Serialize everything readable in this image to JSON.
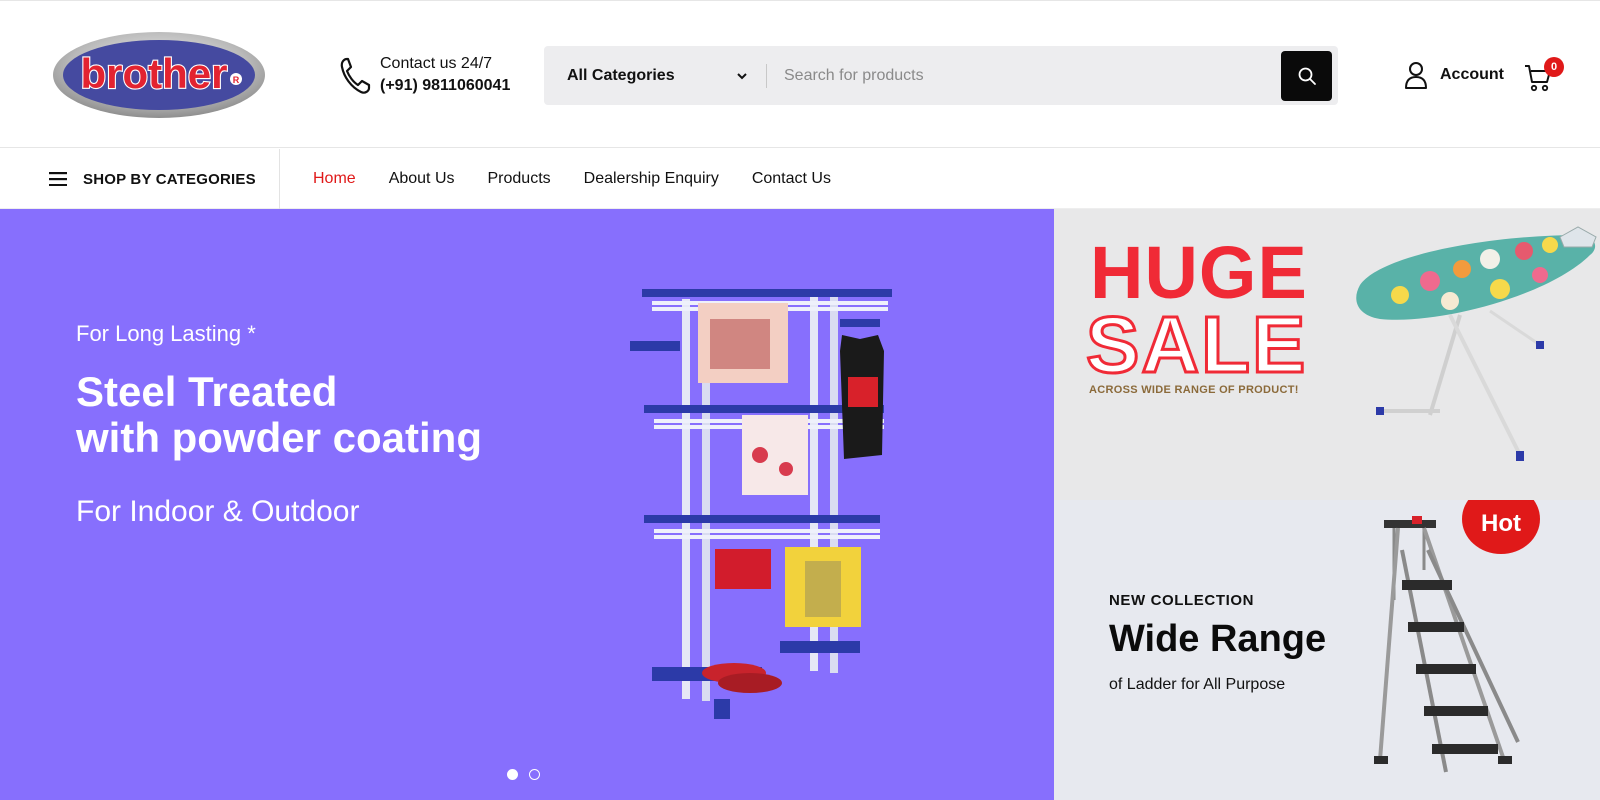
{
  "brand": {
    "logo_text": "brother",
    "logo_mark": "®"
  },
  "contact": {
    "label": "Contact us 24/7",
    "phone": "(+91) 9811060041",
    "icon": "phone-icon"
  },
  "search": {
    "category": "All Categories",
    "placeholder": "Search for products",
    "value": "",
    "icon": "search-icon"
  },
  "account": {
    "label": "Account",
    "icon": "user-icon"
  },
  "cart": {
    "count": "0",
    "icon": "cart-icon"
  },
  "nav": {
    "shop_label": "SHOP BY CATEGORIES",
    "links": [
      {
        "label": "Home",
        "active": true
      },
      {
        "label": "About Us"
      },
      {
        "label": "Products"
      },
      {
        "label": "Dealership Enquiry"
      },
      {
        "label": "Contact Us"
      }
    ]
  },
  "hero": {
    "kicker": "For Long Lasting *",
    "title_line1": "Steel Treated",
    "title_line2": "with powder coating",
    "subtitle": "For Indoor & Outdoor",
    "background": "#876ffd",
    "slides": 2,
    "active_slide": 1
  },
  "banner_sale": {
    "line1": "HUGE",
    "line2": "SALE",
    "note": "ACROSS WIDE RANGE OF PRODUCT!",
    "accent": "#f02a36"
  },
  "banner_ladder": {
    "badge": "Hot",
    "kicker": "NEW COLLECTION",
    "title": "Wide Range",
    "subtitle": "of Ladder for All Purpose"
  },
  "colors": {
    "accent_red": "#e01919",
    "search_bg": "#ededef",
    "hero_purple": "#876ffd"
  }
}
